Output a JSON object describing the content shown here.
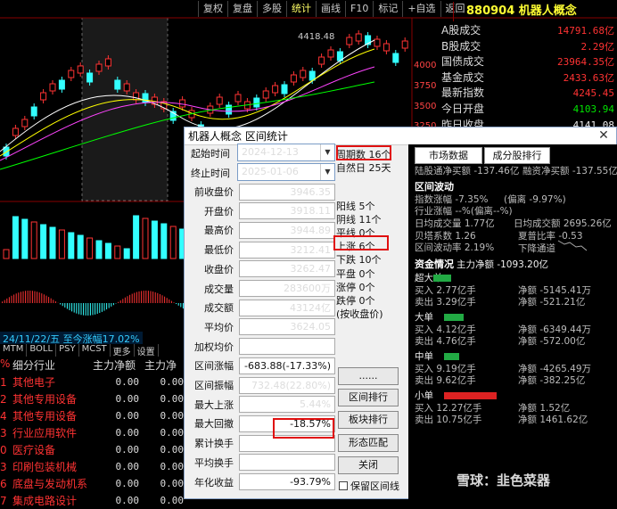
{
  "toolbar": [
    "复权",
    "复盘",
    "多股",
    "统计",
    "画线",
    "F10",
    "标记",
    "+自选",
    "返回"
  ],
  "stock": {
    "title": "880904 机器人概念"
  },
  "quote": [
    {
      "label": "A股成交",
      "value": "14791.68亿",
      "color": "red"
    },
    {
      "label": "B股成交",
      "value": "2.29亿",
      "color": "red"
    },
    {
      "label": "国债成交",
      "value": "23964.35亿",
      "color": "red"
    },
    {
      "label": "基金成交",
      "value": "2433.63亿",
      "color": "red"
    },
    {
      "label": "最新指数",
      "value": "4245.45",
      "color": "red"
    },
    {
      "label": "今日开盘",
      "value": "4103.94",
      "color": "green"
    },
    {
      "label": "昨日收盘",
      "value": "4141.08",
      "color": "white"
    }
  ],
  "yaxis": [
    "4000",
    "3750",
    "3500",
    "3250"
  ],
  "chart_label_high": "4418.48",
  "datebar": "24/11/22/五  至今涨幅17.02%",
  "bottom_tabs": [
    "MTM",
    "BOLL",
    "PSY",
    "MCST",
    "更多",
    "设置"
  ],
  "industry": {
    "headers": [
      "%",
      "细分行业",
      "主力净额",
      "主力净"
    ],
    "rows": [
      {
        "num": "1",
        "name": "其他电子",
        "v1": "0.00",
        "v2": "0.00"
      },
      {
        "num": "2",
        "name": "其他专用设备",
        "v1": "0.00",
        "v2": "0.00"
      },
      {
        "num": "4",
        "name": "其他专用设备",
        "v1": "0.00",
        "v2": "0.00"
      },
      {
        "num": "3",
        "name": "行业应用软件",
        "v1": "0.00",
        "v2": "0.00"
      },
      {
        "num": "0",
        "name": "医疗设备",
        "v1": "0.00",
        "v2": "0.00"
      },
      {
        "num": "3",
        "name": "印刷包装机械",
        "v1": "0.00",
        "v2": "0.00"
      },
      {
        "num": "6",
        "name": "底盘与发动机系",
        "v1": "0.00",
        "v2": "0.00"
      },
      {
        "num": "7",
        "name": "集成电路设计",
        "v1": "0.00",
        "v2": "0.00"
      }
    ]
  },
  "dialog": {
    "title": "机器人概念 区间统计",
    "start_label": "起始时间",
    "start_date": "2024-12-13",
    "end_label": "终止时间",
    "end_date": "2025-01-06",
    "fields": [
      {
        "label": "前收盘价",
        "value": "3946.35"
      },
      {
        "label": "开盘价",
        "value": "3918.11"
      },
      {
        "label": "最高价",
        "value": "3944.89"
      },
      {
        "label": "最低价",
        "value": "3212.41"
      },
      {
        "label": "收盘价",
        "value": "3262.47"
      },
      {
        "label": "成交量",
        "value": "283600万"
      },
      {
        "label": "成交额",
        "value": "43124亿"
      },
      {
        "label": "平均价",
        "value": "3624.05"
      },
      {
        "label": "加权均价",
        "value": ""
      },
      {
        "label": "区间涨幅",
        "value": "-683.88(-17.33%)"
      },
      {
        "label": "区间振幅",
        "value": "732.48(22.80%)"
      },
      {
        "label": "最大上涨",
        "value": "5.44%"
      },
      {
        "label": "最大回撤",
        "value": "-18.57%"
      },
      {
        "label": "累计换手",
        "value": ""
      },
      {
        "label": "平均换手",
        "value": ""
      },
      {
        "label": "年化收益",
        "value": "-93.79%"
      }
    ],
    "stats": [
      "周期数 16个",
      "自然日 25天",
      "",
      "阳线 5个",
      "阴线 11个",
      "平线 0个",
      "上涨 6个",
      "下跌 10个",
      "平盘 0个",
      "涨停 0个",
      "跌停 0个",
      "(按收盘价)"
    ],
    "buttons": {
      "more": "......",
      "sector_rank": "区间排行",
      "board_rank": "板块排行",
      "pattern": "形态匹配",
      "close": "关闭"
    },
    "keep_interval": "保留区间线",
    "tabs": [
      "市场数据",
      "成分股排行"
    ],
    "market": {
      "hsgt_buy": "陆股通净买额 -137.46亿",
      "fund_buy": "融资净买额 -137.55亿",
      "range_title": "区间波动",
      "index_range": "指数涨幅 -7.35%",
      "index_dev": "(偏离 -9.97%)",
      "industry_range": "行业涨幅 --%(偏离--%)",
      "daily_vol": "日均成交量 1.77亿",
      "daily_amt": "日均成交额 2695.26亿",
      "beta": "贝塔系数 1.26",
      "sharpe": "夏普比率 -0.53",
      "volatility": "区间波动率 2.19%",
      "trend": "下降通道",
      "fund_title": "资金情况",
      "main_net": "主力净额 -1093.20亿",
      "blocks": [
        {
          "name": "超大单",
          "buy": "买入 2.77亿手",
          "sell": "卖出 3.29亿手",
          "net_buy": "净额 -5145.41万",
          "net_sell": "净额 -521.21亿",
          "bar_color": "#22aa44",
          "bar_frac": 0.12
        },
        {
          "name": "大单",
          "buy": "买入 4.12亿手",
          "sell": "卖出 4.76亿手",
          "net_buy": "净额 -6349.44万",
          "net_sell": "净额 -572.00亿",
          "bar_color": "#22aa44",
          "bar_frac": 0.13
        },
        {
          "name": "中单",
          "buy": "买入 9.19亿手",
          "sell": "卖出 9.62亿手",
          "net_buy": "净额 -4265.49万",
          "net_sell": "净额 -382.25亿",
          "bar_color": "#22aa44",
          "bar_frac": 0.1
        },
        {
          "name": "小单",
          "buy": "买入 12.27亿手",
          "sell": "卖出 10.75亿手",
          "net_buy": "净额 1.52亿",
          "net_sell": "净额 1461.62亿",
          "bar_color": "#dd2222",
          "bar_frac": 0.35
        }
      ]
    }
  },
  "watermark": "雪球：韭色菜器"
}
